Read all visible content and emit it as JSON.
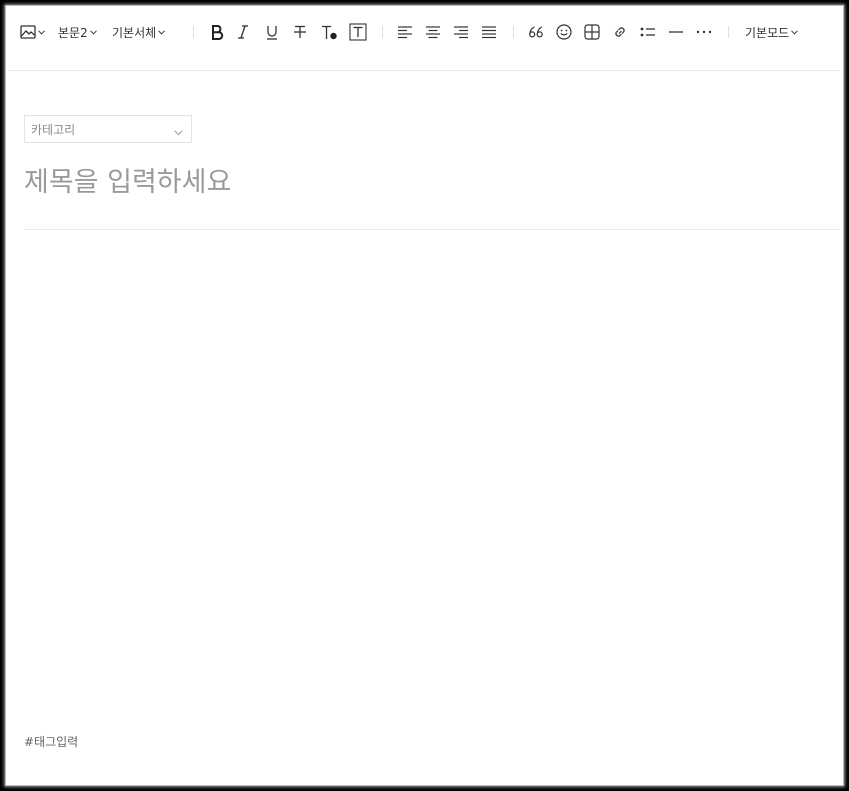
{
  "toolbar": {
    "image_icon": "image-icon",
    "paragraph_style": "본문2",
    "font_family": "기본서체",
    "bold_icon": "bold-icon",
    "italic_icon": "italic-icon",
    "underline_icon": "underline-icon",
    "strikethrough_icon": "strikethrough-icon",
    "text_color_icon": "text-color-icon",
    "text_background_icon": "text-background-icon",
    "align_left_icon": "align-left-icon",
    "align_center_icon": "align-center-icon",
    "align_right_icon": "align-right-icon",
    "align_justify_icon": "align-justify-icon",
    "quote_icon": "quote-icon",
    "emoji_icon": "emoji-icon",
    "table_icon": "table-icon",
    "link_icon": "link-icon",
    "list_icon": "list-icon",
    "divider_icon": "divider-icon",
    "more_icon": "more-icon",
    "mode": "기본모드"
  },
  "category": {
    "placeholder": "카테고리"
  },
  "title": {
    "placeholder": "제목을 입력하세요"
  },
  "tags": {
    "placeholder": "#태그입력"
  },
  "colors": {
    "text": "#333333",
    "placeholder": "#9a9a9a",
    "border": "#e4e4e4"
  }
}
